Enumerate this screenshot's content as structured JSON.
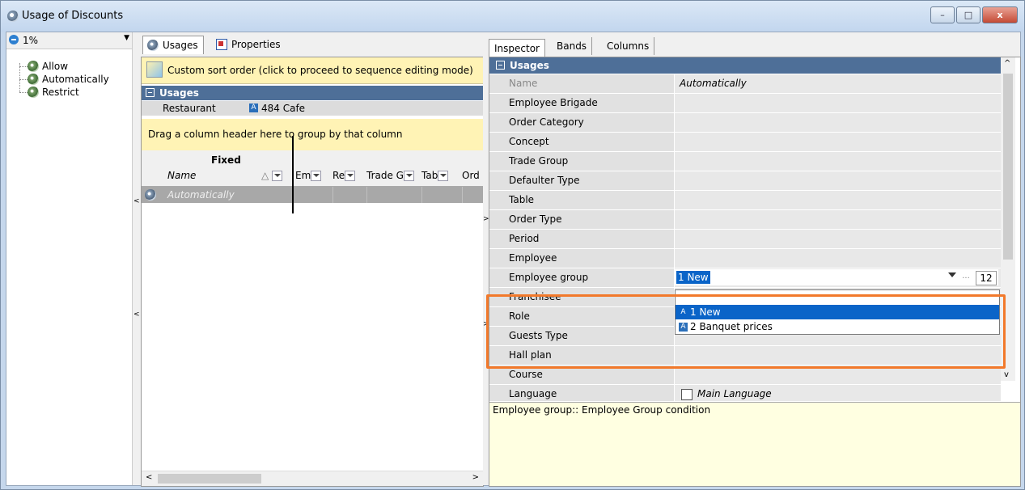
{
  "window": {
    "title": "Usage of Discounts",
    "close_label": "x",
    "min_label": "–",
    "max_label": "□"
  },
  "left": {
    "combo_value": "1%",
    "tree": [
      {
        "label": "Allow"
      },
      {
        "label": "Automatically"
      },
      {
        "label": "Restrict"
      }
    ]
  },
  "mid": {
    "tabs": [
      {
        "label": "Usages"
      },
      {
        "label": "Properties"
      }
    ],
    "sort_text": "Custom sort order (click to proceed to sequence editing mode)",
    "band_title": "Usages",
    "restaurant_label": "Restaurant",
    "restaurant_icon": "A",
    "restaurant_value": "484 Cafe",
    "group_hint": "Drag a column header here to group by that column",
    "fixed_label": "Fixed",
    "name_col": "Name",
    "sort_glyph": "△",
    "cols": [
      {
        "label": "Em"
      },
      {
        "label": "Re"
      },
      {
        "label": "Trade G"
      },
      {
        "label": "Tab"
      },
      {
        "label": "Ord"
      }
    ],
    "row_name": "Automatically"
  },
  "right": {
    "tabs": [
      {
        "label": "Inspector"
      },
      {
        "label": "Bands"
      },
      {
        "label": "Columns"
      }
    ],
    "section_title": "Usages",
    "rows": [
      {
        "label": "Name",
        "value": "Automatically"
      },
      {
        "label": "Employee Brigade",
        "value": ""
      },
      {
        "label": "Order Category",
        "value": ""
      },
      {
        "label": "Concept",
        "value": ""
      },
      {
        "label": "Trade Group",
        "value": ""
      },
      {
        "label": "Defaulter Type",
        "value": ""
      },
      {
        "label": "Table",
        "value": ""
      },
      {
        "label": "Order Type",
        "value": ""
      },
      {
        "label": "Period",
        "value": ""
      },
      {
        "label": "Employee",
        "value": ""
      },
      {
        "label": "Employee group",
        "value": ""
      },
      {
        "label": "Franchisee",
        "value": ""
      },
      {
        "label": "Role",
        "value": ""
      },
      {
        "label": "Guests Type",
        "value": ""
      },
      {
        "label": "Hall plan",
        "value": ""
      },
      {
        "label": "Course",
        "value": ""
      },
      {
        "label": "Language",
        "value": "Main Language"
      }
    ],
    "editor": {
      "value": "1 New",
      "ellipsis": "...",
      "count": "12"
    },
    "options": [
      {
        "icon": "A",
        "label": "1 New"
      },
      {
        "icon": "A",
        "label": "2 Banquet prices"
      }
    ],
    "description": "Employee group:: Employee Group condition"
  },
  "colors": {
    "band": "#4e6f98",
    "highlight": "#f2792b",
    "selection": "#0a64c8",
    "hint": "#fff3b5"
  }
}
